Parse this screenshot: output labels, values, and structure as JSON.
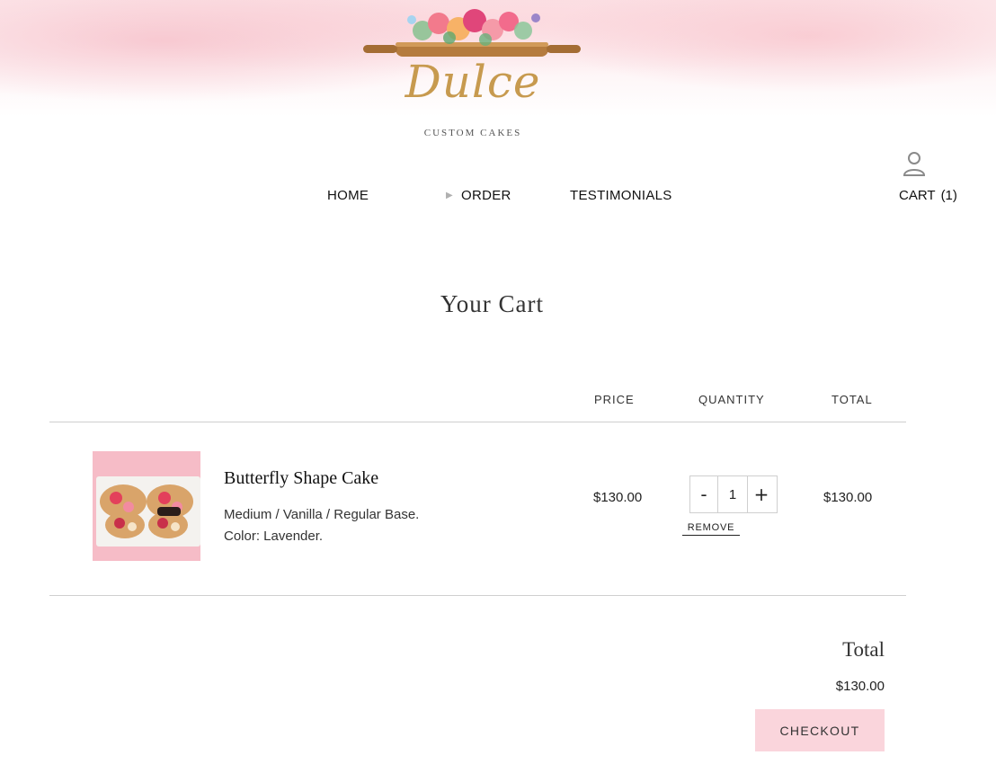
{
  "brand": {
    "name": "Dulce",
    "tagline": "CUSTOM CAKES",
    "logo_icon": "rolling-pin-flowers-logo"
  },
  "nav": {
    "items": [
      {
        "label": "HOME"
      },
      {
        "label": "ORDER",
        "has_arrow": true
      },
      {
        "label": "TESTIMONIALS"
      }
    ],
    "account_icon": "user-icon",
    "cart_label": "CART",
    "cart_count": "(1)"
  },
  "page": {
    "title": "Your Cart"
  },
  "table": {
    "headers": [
      "PRICE",
      "QUANTITY",
      "TOTAL"
    ],
    "items": [
      {
        "name": "Butterfly Shape Cake",
        "variant_line1": "Medium / Vanilla / Regular Base.",
        "variant_line2": "Color: Lavender.",
        "price": "$130.00",
        "quantity": "1",
        "minus": "-",
        "plus": "+",
        "remove_label": "REMOVE",
        "line_total": "$130.00"
      }
    ]
  },
  "summary": {
    "total_label": "Total",
    "total_value": "$130.00",
    "checkout_label": "CHECKOUT"
  },
  "colors": {
    "accent_pink": "#fad5dc",
    "logo_gold": "#c79a4f",
    "text": "#1a1a1a"
  }
}
